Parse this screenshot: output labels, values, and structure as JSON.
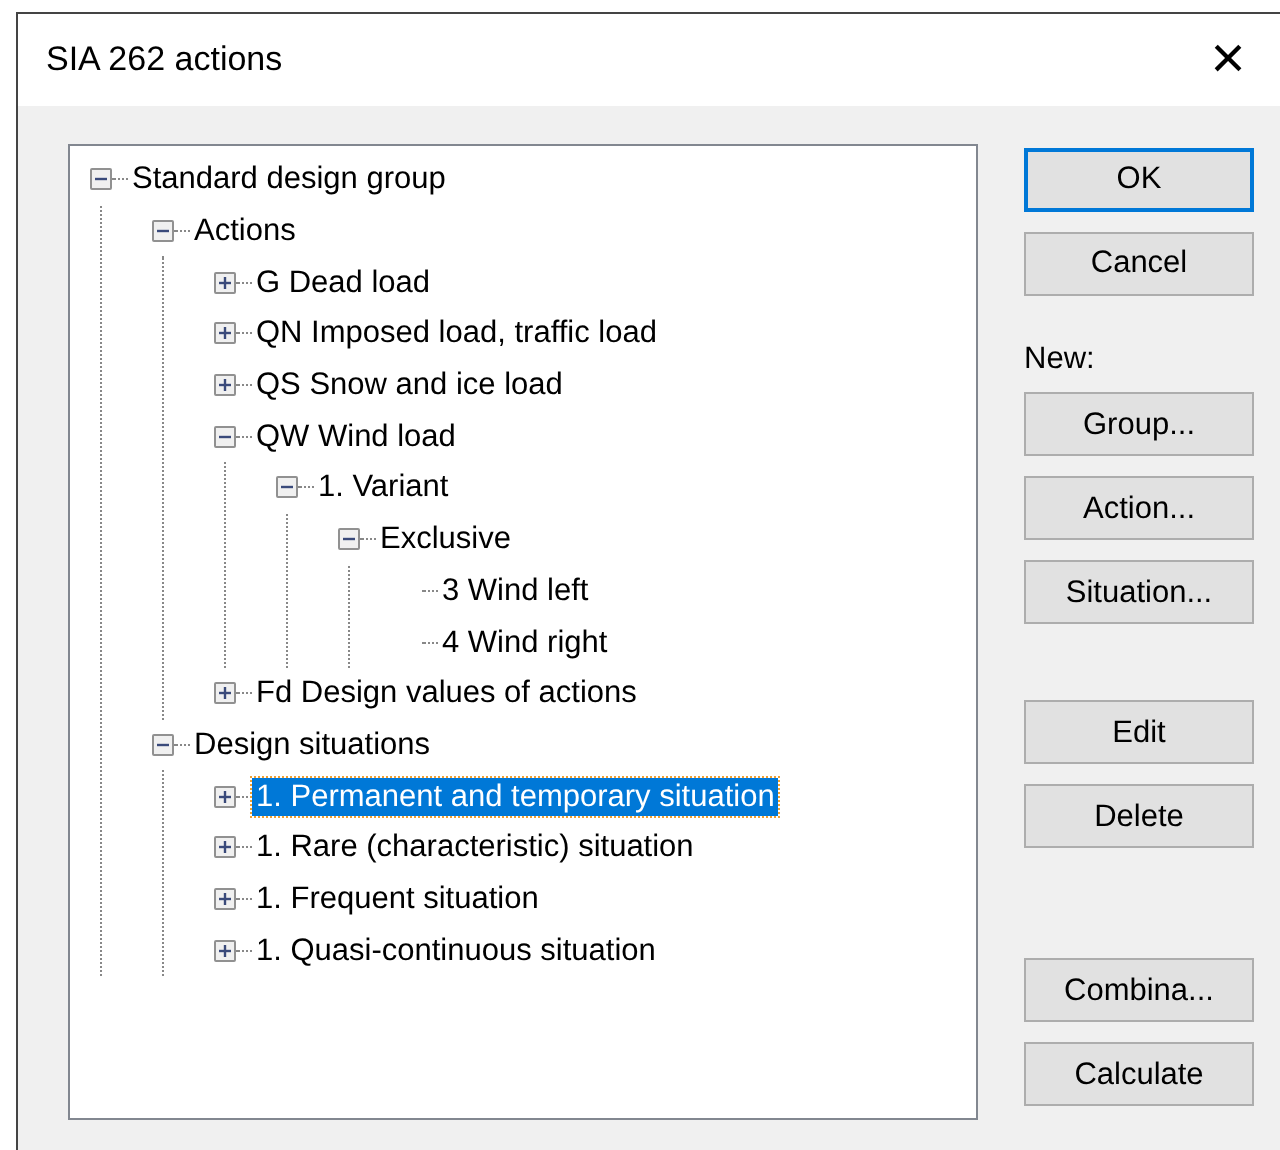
{
  "window": {
    "title": "SIA 262 actions",
    "close": "×"
  },
  "tree": [
    {
      "label": "Standard design group",
      "expanded": true,
      "selected": false,
      "children": [
        {
          "label": "Actions",
          "expanded": true,
          "selected": false,
          "children": [
            {
              "label": "G Dead load",
              "expanded": false,
              "selected": false
            },
            {
              "label": "QN Imposed load, traffic load",
              "expanded": false,
              "selected": false
            },
            {
              "label": "QS Snow and ice load",
              "expanded": false,
              "selected": false
            },
            {
              "label": "QW Wind load",
              "expanded": true,
              "selected": false,
              "children": [
                {
                  "label": "1. Variant",
                  "expanded": true,
                  "selected": false,
                  "children": [
                    {
                      "label": "Exclusive",
                      "expanded": true,
                      "selected": false,
                      "children": [
                        {
                          "label": "3 Wind left",
                          "selected": false
                        },
                        {
                          "label": "4 Wind right",
                          "selected": false
                        }
                      ]
                    }
                  ]
                }
              ]
            },
            {
              "label": "Fd Design values of actions",
              "expanded": false,
              "selected": false
            }
          ]
        },
        {
          "label": "Design situations",
          "expanded": true,
          "selected": false,
          "children": [
            {
              "label": "1. Permanent and temporary situation",
              "expanded": false,
              "selected": true
            },
            {
              "label": "1. Rare (characteristic) situation",
              "expanded": false,
              "selected": false
            },
            {
              "label": "1. Frequent situation",
              "expanded": false,
              "selected": false
            },
            {
              "label": "1. Quasi-continuous situation",
              "expanded": false,
              "selected": false
            }
          ]
        }
      ]
    }
  ],
  "buttons": [
    {
      "kind": "button",
      "label": "OK",
      "default": true
    },
    {
      "kind": "button",
      "label": "Cancel",
      "default": false
    },
    {
      "kind": "heading",
      "label": "New:"
    },
    {
      "kind": "button",
      "label": "Group...",
      "default": false
    },
    {
      "kind": "button",
      "label": "Action...",
      "default": false
    },
    {
      "kind": "button",
      "label": "Situation...",
      "default": false
    },
    {
      "kind": "gap"
    },
    {
      "kind": "button",
      "label": "Edit",
      "default": false
    },
    {
      "kind": "button",
      "label": "Delete",
      "default": false
    },
    {
      "kind": "gap2"
    },
    {
      "kind": "button",
      "label": "Combina...",
      "default": false
    },
    {
      "kind": "button",
      "label": "Calculate",
      "default": false
    }
  ]
}
